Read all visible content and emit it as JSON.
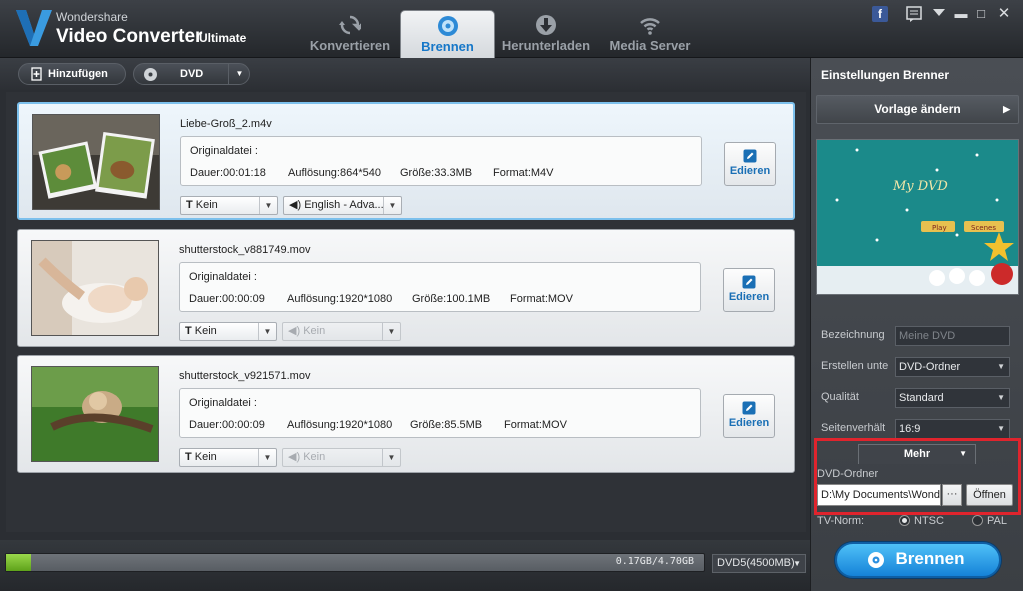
{
  "app": {
    "brand_top": "Wondershare",
    "brand_main": "Video Converter",
    "brand_edition": "Ultimate"
  },
  "tabs": [
    {
      "label": "Konvertieren",
      "icon": "refresh-icon"
    },
    {
      "label": "Brennen",
      "icon": "disc-icon",
      "active": true
    },
    {
      "label": "Herunterladen",
      "icon": "download-icon"
    },
    {
      "label": "Media Server",
      "icon": "wifi-icon"
    }
  ],
  "toolbar": {
    "add_label": "Hinzufügen",
    "disc_label": "DVD"
  },
  "files": [
    {
      "name": "Liebe-Groß_2.m4v",
      "orig_label": "Originaldatei :",
      "duration": "Dauer:00:01:18",
      "resolution": "Auflösung:864*540",
      "size": "Größe:33.3MB",
      "format": "Format:M4V",
      "subtitle": "Kein",
      "audio": "English - Adva...",
      "audio_disabled": false,
      "edit_label": "Edieren",
      "selected": true
    },
    {
      "name": "shutterstock_v881749.mov",
      "orig_label": "Originaldatei :",
      "duration": "Dauer:00:00:09",
      "resolution": "Auflösung:1920*1080",
      "size": "Größe:100.1MB",
      "format": "Format:MOV",
      "subtitle": "Kein",
      "audio": "Kein",
      "audio_disabled": true,
      "edit_label": "Edieren",
      "selected": false
    },
    {
      "name": "shutterstock_v921571.mov",
      "orig_label": "Originaldatei :",
      "duration": "Dauer:00:00:09",
      "resolution": "Auflösung:1920*1080",
      "size": "Größe:85.5MB",
      "format": "Format:MOV",
      "subtitle": "Kein",
      "audio": "Kein",
      "audio_disabled": true,
      "edit_label": "Edieren",
      "selected": false
    }
  ],
  "bottom": {
    "progress_fraction": 0.036,
    "progress_text": "0.17GB/4.70GB",
    "disc_type": "DVD5(4500MB)",
    "burn_label": "Brennen"
  },
  "settings": {
    "title": "Einstellungen Brenner",
    "template_button": "Vorlage ändern",
    "preview_title": "My DVD",
    "preview_play": "Play",
    "preview_scenes": "Scenes",
    "name_label": "Bezeichnung",
    "name_placeholder": "Meine DVD",
    "create_label": "Erstellen unte",
    "create_value": "DVD-Ordner",
    "quality_label": "Qualität",
    "quality_value": "Standard",
    "aspect_label": "Seitenverhält",
    "aspect_value": "16:9",
    "more_label": "Mehr",
    "folder_label": "DVD-Ordner",
    "folder_path": "D:\\My Documents\\Wonde",
    "browse_label": "···",
    "open_label": "Öffnen",
    "tv_label": "TV-Norm:",
    "ntsc_label": "NTSC",
    "pal_label": "PAL",
    "tv_norm": "NTSC"
  },
  "colors": {
    "accent": "#1677c8",
    "highlight_box": "#e0242d",
    "progress_fill": "#7cc236"
  }
}
